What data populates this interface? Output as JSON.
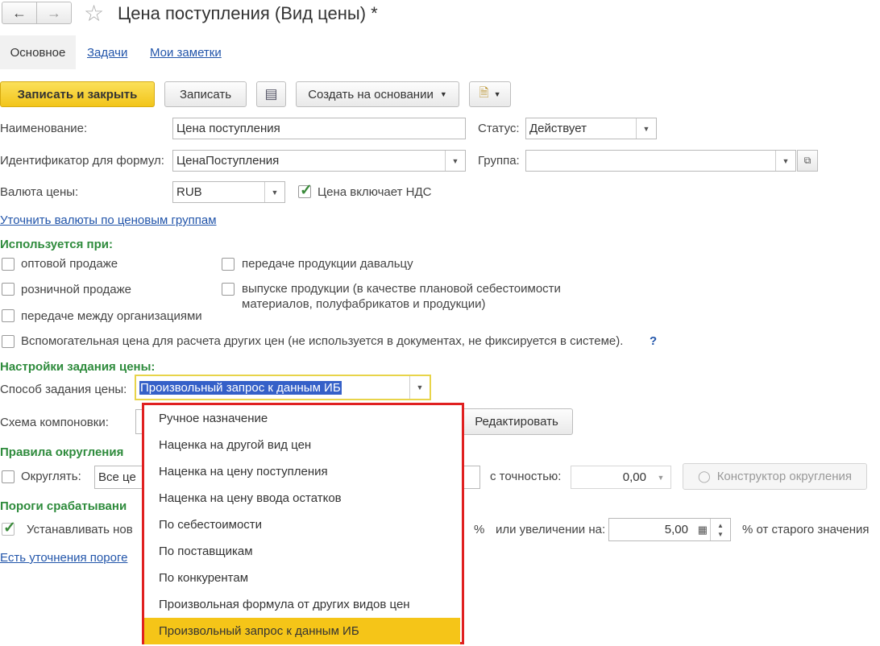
{
  "window": {
    "title": "Цена поступления (Вид цены) *"
  },
  "tabs": [
    {
      "label": "Основное"
    },
    {
      "label": "Задачи"
    },
    {
      "label": "Мои заметки"
    }
  ],
  "toolbar": {
    "save_close": "Записать и закрыть",
    "save": "Записать",
    "create_based": "Создать на основании"
  },
  "form": {
    "name_label": "Наименование:",
    "name_value": "Цена поступления",
    "status_label": "Статус:",
    "status_value": "Действует",
    "formula_id_label": "Идентификатор для формул:",
    "formula_id_value": "ЦенаПоступления",
    "group_label": "Группа:",
    "group_value": "",
    "currency_label": "Валюта цены:",
    "currency_value": "RUB",
    "vat_included": {
      "label": "Цена включает НДС",
      "checked": true
    },
    "refine_currencies_link": "Уточнить валюты по ценовым группам"
  },
  "used_when": {
    "header": "Используется при:",
    "wholesale": {
      "label": "оптовой продаже",
      "checked": false
    },
    "retail": {
      "label": "розничной продаже",
      "checked": false
    },
    "between_orgs": {
      "label": "передаче между организациями",
      "checked": false
    },
    "to_supplier": {
      "label": "передаче продукции давальцу",
      "checked": false
    },
    "production": {
      "label": "выпуске продукции (в качестве плановой себестоимости",
      "label2": "материалов, полуфабрикатов и продукции)",
      "checked": false
    },
    "auxiliary": {
      "label": "Вспомогательная цена для расчета других цен (не используется в документах, не фиксируется в системе).",
      "checked": false
    },
    "help": "?"
  },
  "price_settings": {
    "header": "Настройки задания цены:",
    "method_label": "Способ задания цены:",
    "method_value": "Произвольный запрос к данным ИБ",
    "scheme_label": "Схема компоновки:",
    "edit_button": "Редактировать"
  },
  "rounding": {
    "header": "Правила округления ",
    "round_label": "Округлять:",
    "round_checked": false,
    "round_value": "Все це",
    "precision_label": "с точностью:",
    "precision_value": "0,00",
    "constructor_button": "Конструктор округления"
  },
  "thresholds": {
    "header": "Пороги срабатывани",
    "set_label": "Устанавливать нов",
    "set_checked": true,
    "percent_sign": "%",
    "increase_label": "или увеличении на:",
    "increase_value": "5,00",
    "of_old_label": "% от старого значения",
    "refine_link": "Есть уточнения пороге"
  },
  "dropdown": {
    "items": [
      {
        "label": "Ручное назначение",
        "selected": false
      },
      {
        "label": "Наценка на другой вид цен",
        "selected": false
      },
      {
        "label": "Наценка на цену поступления",
        "selected": false
      },
      {
        "label": "Наценка на цену ввода остатков",
        "selected": false
      },
      {
        "label": "По себестоимости",
        "selected": false
      },
      {
        "label": "По поставщикам",
        "selected": false
      },
      {
        "label": "По конкурентам",
        "selected": false
      },
      {
        "label": "Произвольная формула от других видов цен",
        "selected": false
      },
      {
        "label": "Произвольный запрос к данным ИБ",
        "selected": true
      }
    ]
  },
  "colors": {
    "accent_yellow": "#f5c518",
    "green_header": "#2e8b3c",
    "link": "#2255aa",
    "highlight_red": "#e02020"
  }
}
